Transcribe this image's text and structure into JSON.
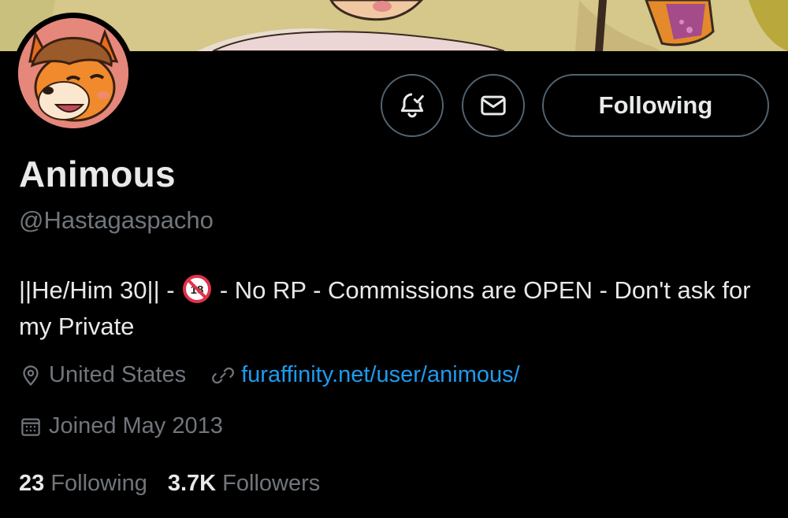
{
  "profile": {
    "display_name": "Animous",
    "handle": "@Hastagaspacho",
    "bio_part1": "||He/Him 30|| - ",
    "bio_emoji": "18+ prohibited icon",
    "bio_part2": " - No RP - Commissions are OPEN - Don't ask for my Private",
    "location": "United States",
    "website": "furaffinity.net/user/animous/",
    "joined": "Joined May 2013",
    "following_count": "23",
    "following_label": "Following",
    "followers_count": "3.7K",
    "followers_label": "Followers"
  },
  "actions": {
    "notify_icon": "bell-check-icon",
    "message_icon": "envelope-icon",
    "follow_label": "Following"
  },
  "colors": {
    "background": "#000000",
    "text_primary": "#e7e9ea",
    "text_secondary": "#71767b",
    "link": "#1d9bf0",
    "border": "#536471"
  }
}
